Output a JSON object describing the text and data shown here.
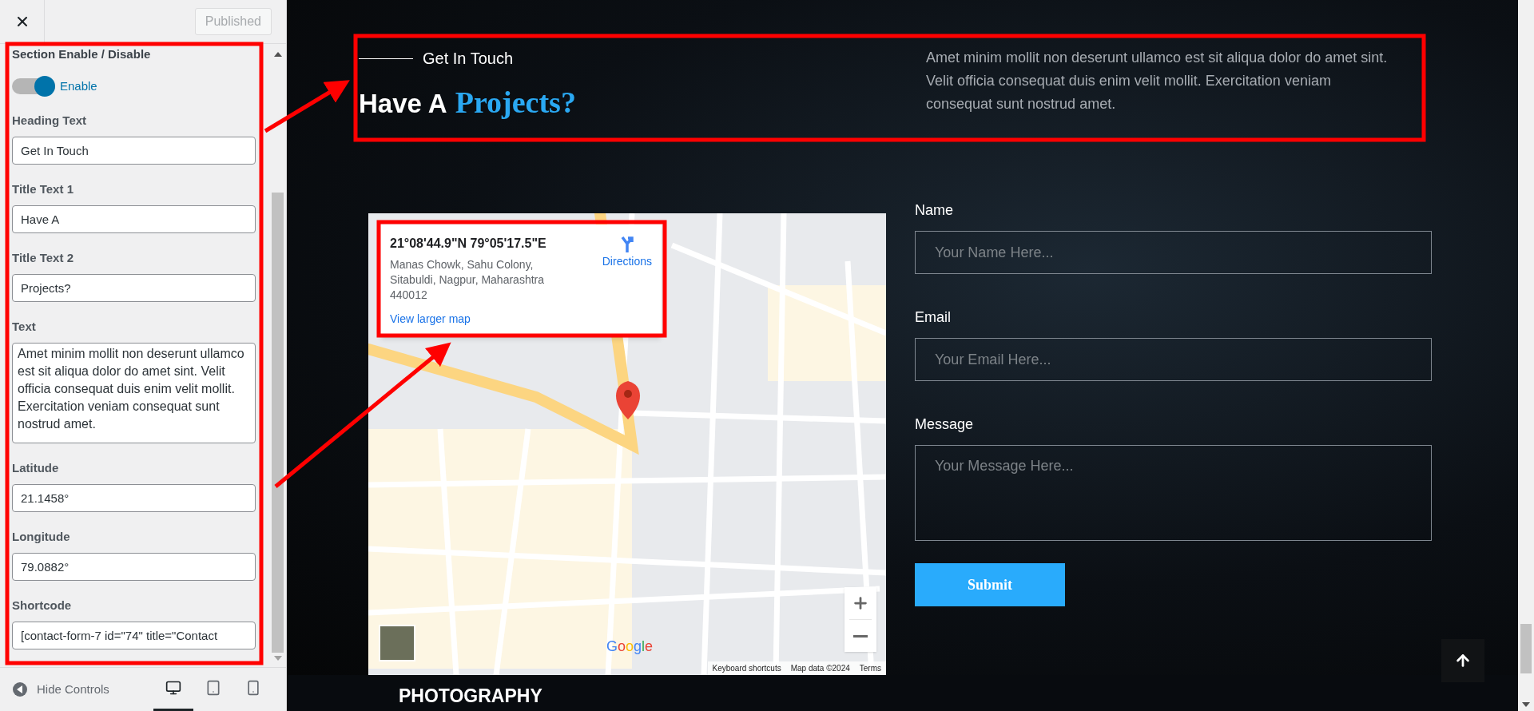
{
  "customizer": {
    "publish_button": {
      "label": "Published",
      "disabled": true
    },
    "section_title": "Section Enable / Disable",
    "toggle": {
      "on": true,
      "label": "Enable"
    },
    "fields": [
      {
        "kind": "input",
        "label": "Heading Text",
        "value": "Get In Touch"
      },
      {
        "kind": "input",
        "label": "Title Text 1",
        "value": "Have A"
      },
      {
        "kind": "input",
        "label": "Title Text 2",
        "value": "Projects?"
      },
      {
        "kind": "textarea",
        "label": "Text",
        "value": "Amet minim mollit non deserunt ullamco est sit aliqua dolor do amet sint. Velit officia consequat duis enim velit mollit. Exercitation veniam consequat sunt nostrud amet."
      },
      {
        "kind": "input",
        "label": "Latitude",
        "value": "21.1458°"
      },
      {
        "kind": "input",
        "label": "Longitude",
        "value": "79.0882°"
      },
      {
        "kind": "input",
        "label": "Shortcode",
        "value": "[contact-form-7 id=\"74\" title=\"Contact"
      }
    ],
    "bottom_bar": {
      "hide_controls": "Hide Controls",
      "devices": [
        {
          "kind": "desktop",
          "selected": true
        },
        {
          "kind": "tablet",
          "selected": false
        },
        {
          "kind": "mobile",
          "selected": false
        }
      ]
    }
  },
  "preview": {
    "heading": {
      "eyebrow": "Get In Touch",
      "title_1": "Have A",
      "title_2": "Projects?",
      "text": "Amet minim mollit non deserunt ullamco est sit aliqua dolor do amet sint. Velit officia consequat duis enim velit mollit. Exercitation veniam consequat sunt nostrud amet."
    },
    "map": {
      "coordinates": "21°08'44.9\"N 79°05'17.5\"E",
      "address": "Manas Chowk, Sahu Colony, Sitabuldi, Nagpur, Maharashtra 440012",
      "directions": "Directions",
      "larger_map": "View larger map",
      "logo": "Google",
      "attribution": [
        "Keyboard shortcuts",
        "Map data ©2024",
        "Terms"
      ]
    },
    "form": {
      "fields": [
        {
          "kind": "input",
          "label": "Name",
          "placeholder": "Your Name Here..."
        },
        {
          "kind": "input",
          "label": "Email",
          "placeholder": "Your Email Here..."
        },
        {
          "kind": "textarea",
          "label": "Message",
          "placeholder": "Your Message Here..."
        }
      ],
      "submit": "Submit"
    },
    "footer": {
      "title": "PHOTOGRAPHY"
    }
  }
}
